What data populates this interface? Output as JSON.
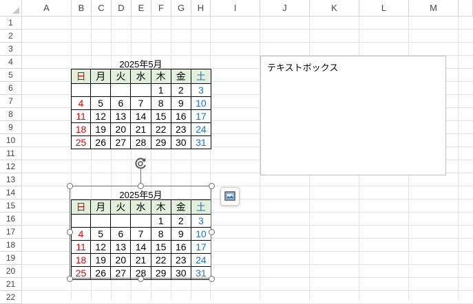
{
  "column_headers": [
    "A",
    "B",
    "C",
    "D",
    "E",
    "F",
    "G",
    "H",
    "I",
    "J",
    "K",
    "L",
    "M"
  ],
  "row_headers": [
    "1",
    "2",
    "3",
    "4",
    "5",
    "6",
    "7",
    "8",
    "9",
    "10",
    "11",
    "12",
    "13",
    "14",
    "15",
    "16",
    "17",
    "18",
    "19",
    "20",
    "21",
    "22"
  ],
  "colors": {
    "header_fill": "#e2efda",
    "sunday": "#e00000",
    "saturday": "#1e6fc8",
    "grid": "#e2e2e2"
  },
  "calendar_top": {
    "title": "2025年5月",
    "weekdays": [
      "日",
      "月",
      "火",
      "水",
      "木",
      "金",
      "土"
    ],
    "weeks": [
      [
        "",
        "",
        "",
        "",
        "1",
        "2",
        "3"
      ],
      [
        "4",
        "5",
        "6",
        "7",
        "8",
        "9",
        "10"
      ],
      [
        "11",
        "12",
        "13",
        "14",
        "15",
        "16",
        "17"
      ],
      [
        "18",
        "19",
        "20",
        "21",
        "22",
        "23",
        "24"
      ],
      [
        "25",
        "26",
        "27",
        "28",
        "29",
        "30",
        "31"
      ]
    ]
  },
  "calendar_picture": {
    "title": "2025年5月",
    "weekdays": [
      "日",
      "月",
      "火",
      "水",
      "木",
      "金",
      "土"
    ],
    "weeks": [
      [
        "",
        "",
        "",
        "",
        "1",
        "2",
        "3"
      ],
      [
        "4",
        "5",
        "6",
        "7",
        "8",
        "9",
        "10"
      ],
      [
        "11",
        "12",
        "13",
        "14",
        "15",
        "16",
        "17"
      ],
      [
        "18",
        "19",
        "20",
        "21",
        "22",
        "23",
        "24"
      ],
      [
        "25",
        "26",
        "27",
        "28",
        "29",
        "30",
        "31"
      ]
    ]
  },
  "textbox": {
    "text": "テキストボックス"
  },
  "icons": {
    "rotate": "rotate-handle-icon",
    "quick_analysis": "image-format-icon"
  }
}
